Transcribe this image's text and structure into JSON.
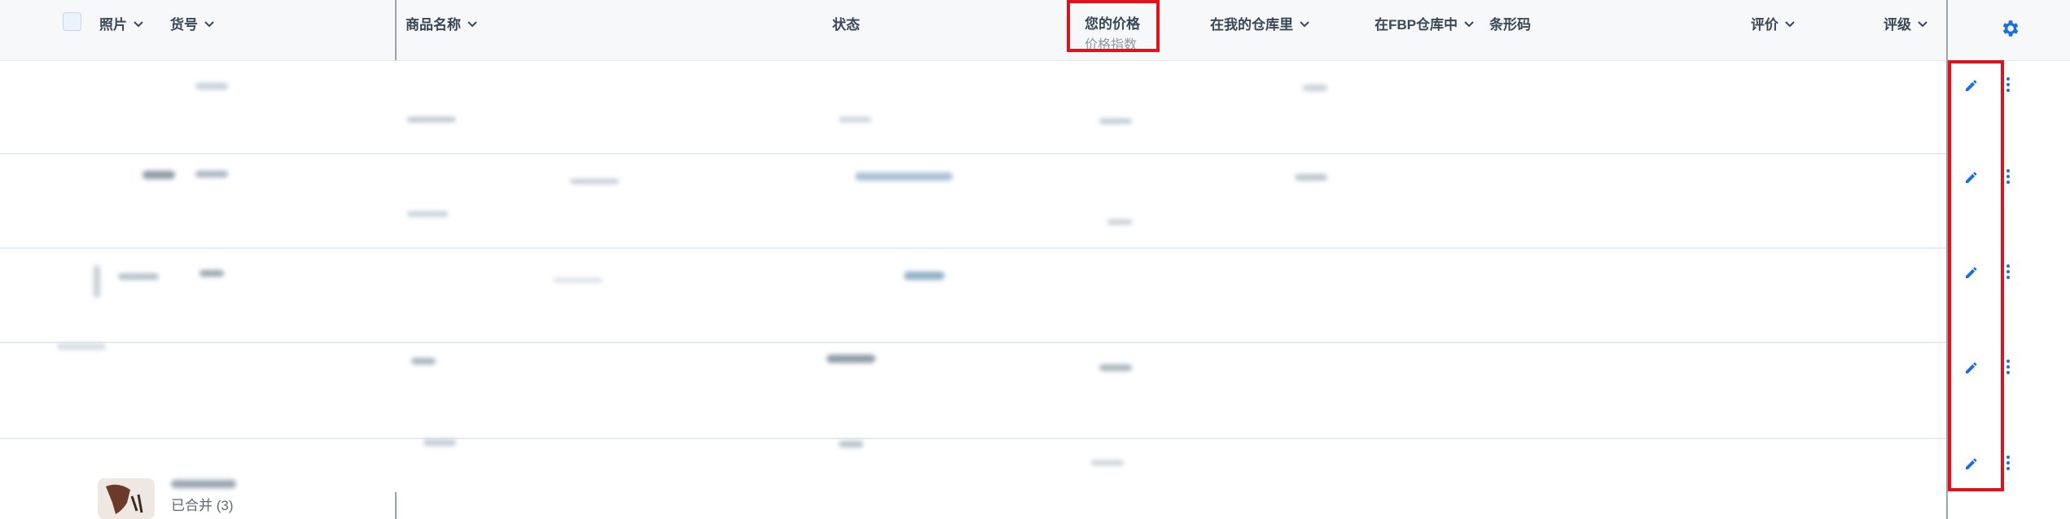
{
  "header": {
    "photo": "照片",
    "sku": "货号",
    "product_name": "商品名称",
    "status": "状态",
    "your_price": "您的价格",
    "price_index": "价格指数",
    "in_my_warehouse": "在我的仓库里",
    "in_fbp_warehouse": "在FBP仓库中",
    "barcode": "条形码",
    "rating": "评价",
    "grade": "评级"
  },
  "icons": {
    "settings": "gear-icon",
    "edit": "pencil-icon",
    "more": "vertical-dots-icon",
    "sort": "chevron-down-icon"
  },
  "rows": [
    {
      "id": "row-1"
    },
    {
      "id": "row-2"
    },
    {
      "id": "row-3"
    },
    {
      "id": "row-4"
    },
    {
      "id": "row-5"
    }
  ],
  "footer_row": {
    "merged_label": "已合并 (3)"
  },
  "colors": {
    "accent": "#1a6fe0",
    "highlight": "#e0121b",
    "header_bg": "#f6f8fa"
  }
}
